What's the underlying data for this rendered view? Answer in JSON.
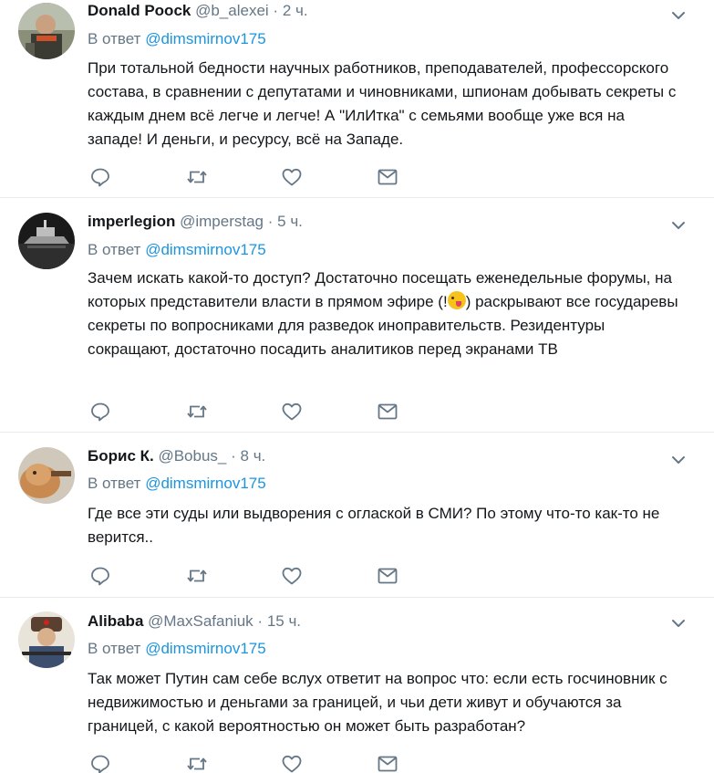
{
  "ui": {
    "colors": {
      "link": "#1b95e0",
      "meta": "#657786",
      "text": "#14171a",
      "divider": "#e6ecf0"
    },
    "icons": {
      "reply": "reply-icon",
      "retweet": "retweet-icon",
      "like": "heart-icon",
      "dm": "envelope-icon",
      "more": "chevron-down-icon"
    }
  },
  "tweets": [
    {
      "name": "Donald Poock",
      "handle": "@b_alexei",
      "sep": "·",
      "time": "2 ч.",
      "reply_prefix": "В ответ",
      "reply_to": "@dimsmirnov175",
      "text": "При тотальной бедности научных работников, преподавателей, профессорского состава, в сравнении с депутатами и чиновниками, шпионам добывать секреты с каждым днем всё легче и легче! А \"ИлИтка\" с семьями вообще уже вся на западе! И деньги, и ресурсу, всё на Западе."
    },
    {
      "name": "imperlegion",
      "handle": "@imperstag",
      "sep": "·",
      "time": "5 ч.",
      "reply_prefix": "В ответ",
      "reply_to": "@dimsmirnov175",
      "text_before_emoji": "Зачем искать какой-то доступ? Достаточно посещать еженедельные форумы, на которых представители власти в прямом эфире (!",
      "text_after_emoji": ") раскрывают все государевы секреты по вопросниками для разведок иноправительств. Резидентуры сокращают, достаточно посадить аналитиков перед экранами ТВ"
    },
    {
      "name": "Борис К.",
      "handle": "@Bobus_",
      "sep": "·",
      "time": "8 ч.",
      "reply_prefix": "В ответ",
      "reply_to": "@dimsmirnov175",
      "text": "Где все эти суды или выдворения с оглаской в СМИ? По этому что-то как-то не верится.."
    },
    {
      "name": "Alibaba",
      "handle": "@MaxSafaniuk",
      "sep": "·",
      "time": "15 ч.",
      "reply_prefix": "В ответ",
      "reply_to": "@dimsmirnov175",
      "text": "Так может Путин сам себе вслух ответит на вопрос что: если есть госчиновник с недвижимостью и деньгами за границей, и чьи дети живут и обучаются за границей, с какой вероятностью он может быть разработан?"
    }
  ]
}
